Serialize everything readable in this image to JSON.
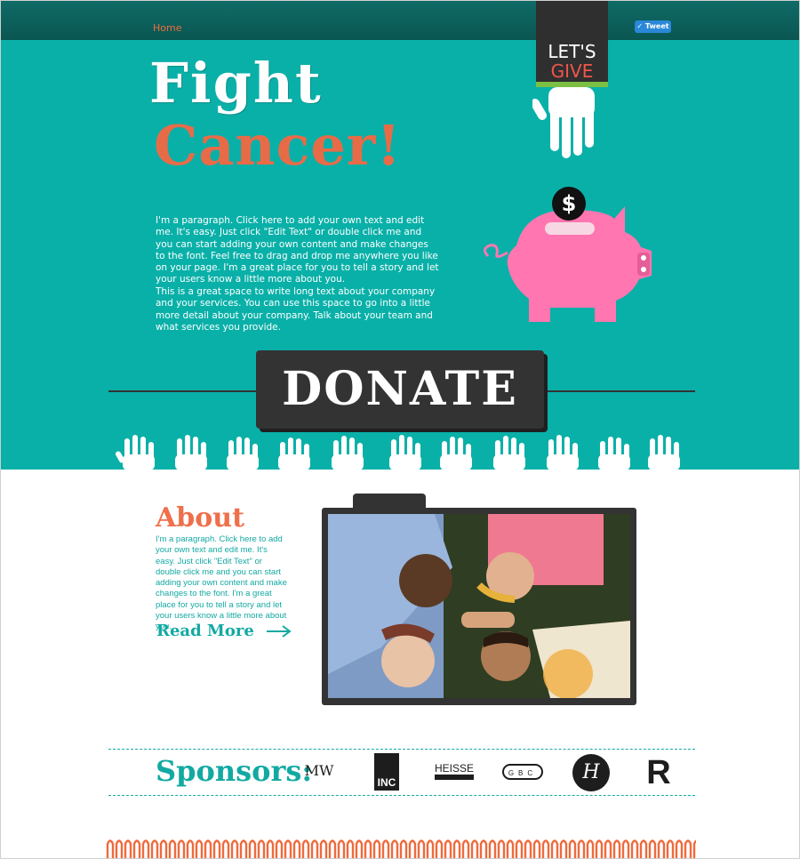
{
  "nav": {
    "home_label": "Home",
    "tweet_label": "Tweet"
  },
  "hero": {
    "title_line1": "Fight",
    "title_line2": "Cancer!",
    "banner_line1": "LET'S",
    "banner_line2": "GIVE",
    "paragraph1": "I'm a paragraph. Click here to add your own text and edit me. It's easy. Just click \"Edit Text\" or double click me and you can start adding your own content and make changes to the font. Feel free to drag and drop me anywhere you like on your page. I'm a great place for you to tell a story and let your users know a little more about you.",
    "paragraph2": "This is a great space to write long text about your company and your services. You can use this space to go into a little more detail about your company. Talk about your team and what services you provide.",
    "donate_label": "DONATE",
    "coin_symbol": "$"
  },
  "about": {
    "title": "About",
    "text": "I'm a paragraph. Click here to add your own text and edit me. It's easy. Just click \"Edit Text\" or double click me and you can start adding your own content and make changes to the font. I'm a great place for you to tell a story and let your users know a little more about you.",
    "read_more_label": "Read More"
  },
  "sponsors": {
    "title": "Sponsors:",
    "logos": [
      "MW",
      "INC",
      "HEISSE",
      "GBC",
      "H",
      "R"
    ]
  },
  "colors": {
    "teal": "#09b0a8",
    "dark_teal": "#0a5652",
    "orange": "#f26b3a",
    "pig_pink": "#ff76b0",
    "charcoal": "#333333"
  }
}
